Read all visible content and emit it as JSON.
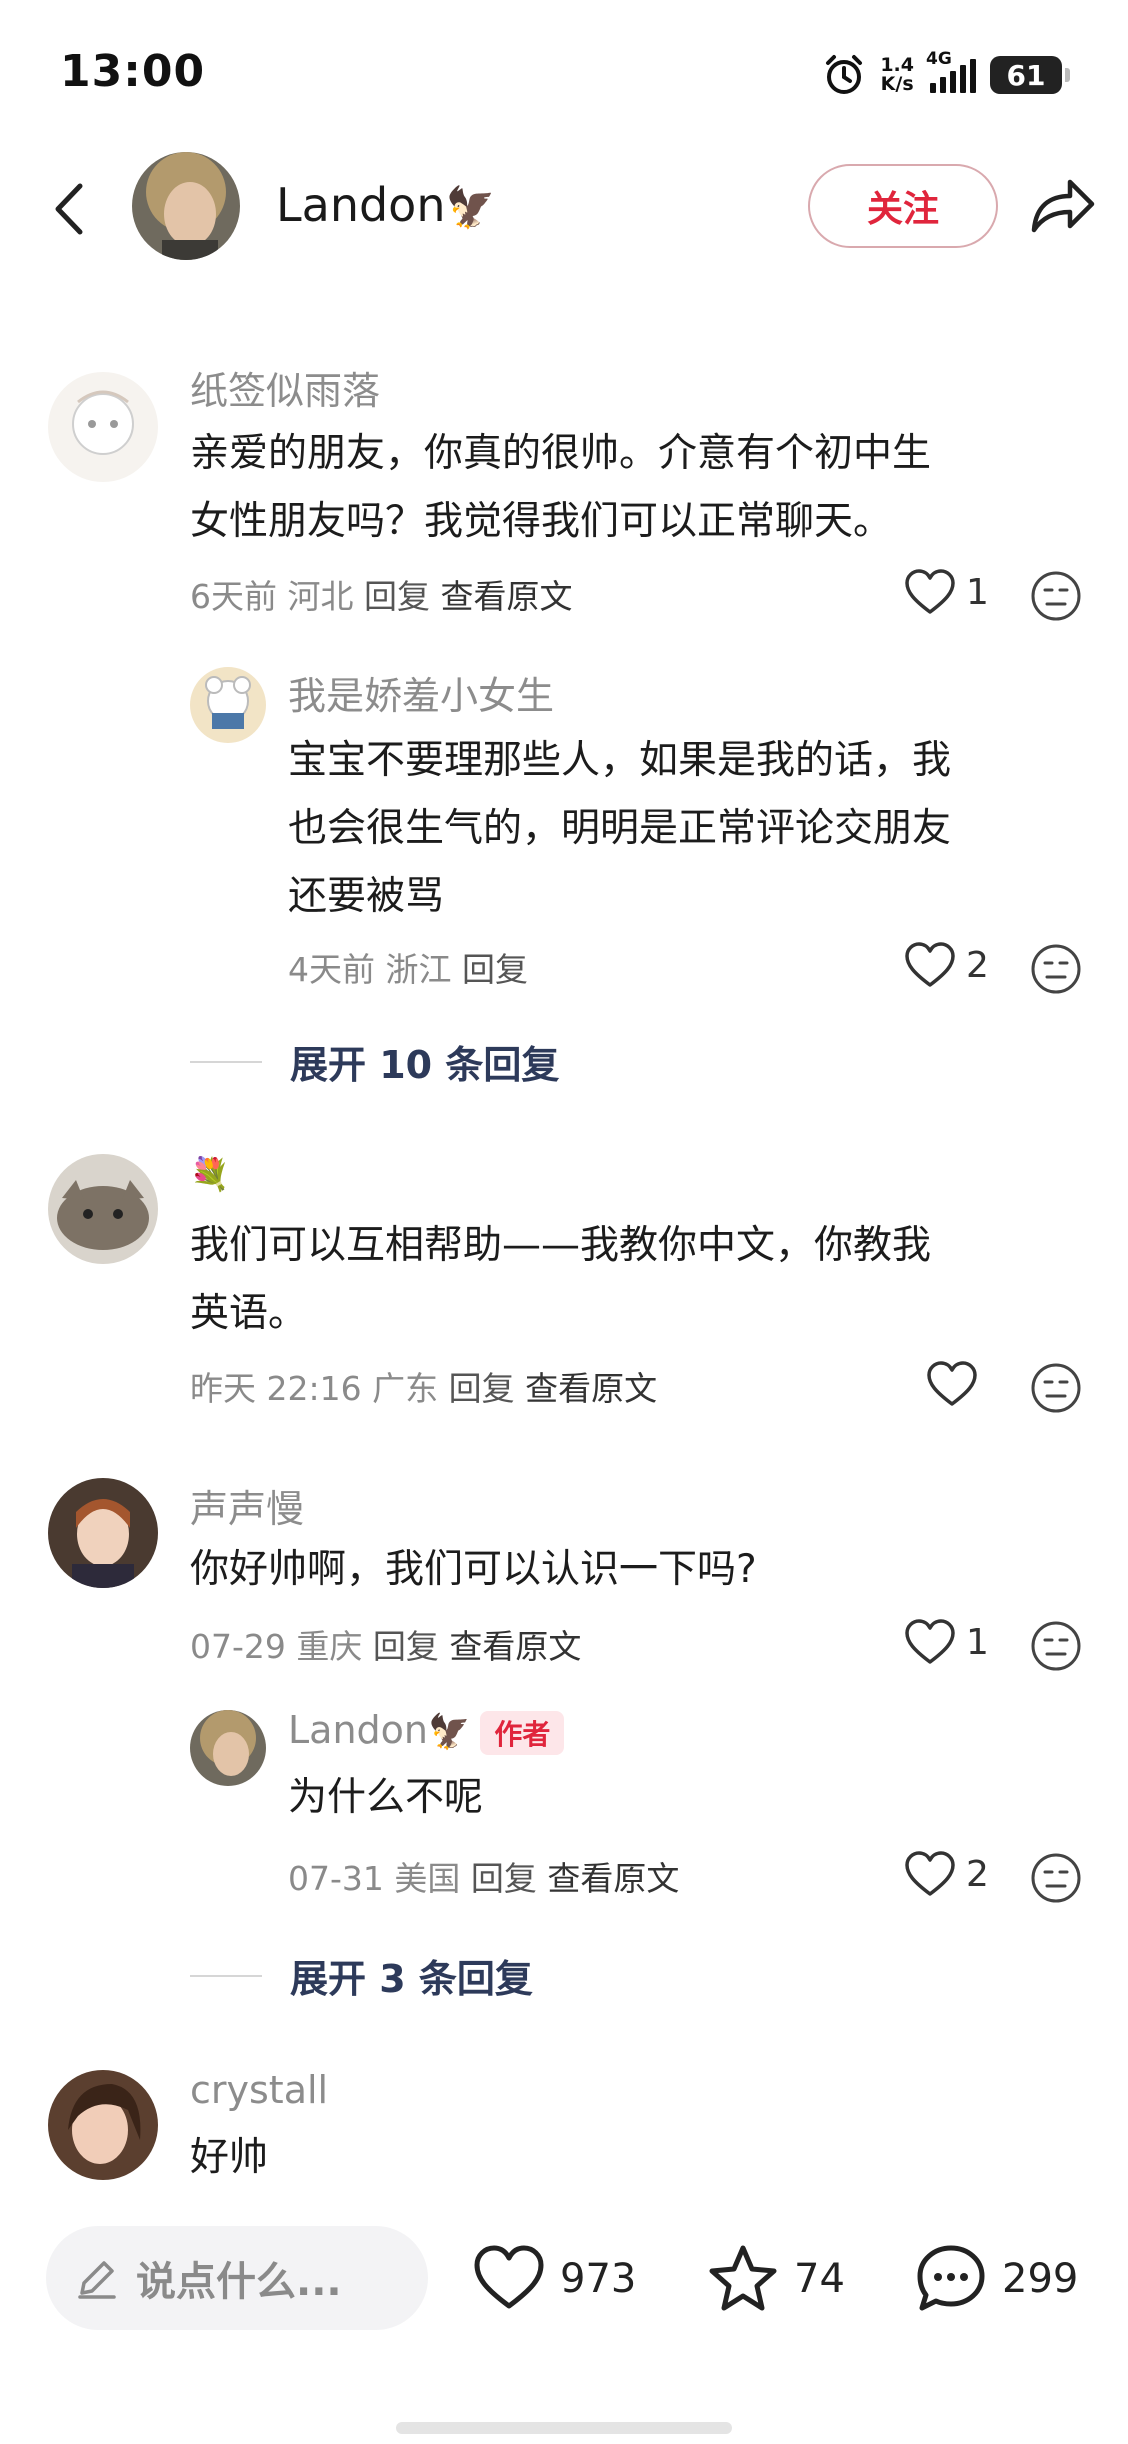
{
  "status": {
    "time": "13:00",
    "net_speed_top": "1.4",
    "net_speed_bottom": "K/s",
    "net_type": "4G",
    "battery": "61"
  },
  "header": {
    "username": "Landon",
    "follow_label": "关注"
  },
  "comments": [
    {
      "username": "纸签似雨落",
      "content_line1": "亲爱的朋友，你真的很帅。介意有个初中生",
      "content_line2": "女性朋友吗？我觉得我们可以正常聊天。",
      "time": "6天前",
      "location": "河北",
      "reply_label": "回复",
      "original_label": "查看原文",
      "likes": "1",
      "replies": [
        {
          "username": "我是娇羞小女生",
          "content_line1": "宝宝不要理那些人，如果是我的话，我",
          "content_line2": "也会很生气的，明明是正常评论交朋友",
          "content_line3": "还要被骂",
          "time": "4天前",
          "location": "浙江",
          "reply_label": "回复",
          "likes": "2"
        }
      ],
      "expand_label": "展开 10 条回复"
    },
    {
      "username": "",
      "content_line1": "我们可以互相帮助——我教你中文，你教我",
      "content_line2": "英语。",
      "time": "昨天 22:16",
      "location": "广东",
      "reply_label": "回复",
      "original_label": "查看原文",
      "likes": ""
    },
    {
      "username": "声声慢",
      "content_line1": "你好帅啊，我们可以认识一下吗?",
      "time": "07-29",
      "location": "重庆",
      "reply_label": "回复",
      "original_label": "查看原文",
      "likes": "1",
      "replies": [
        {
          "username": "Landon",
          "badge": "作者",
          "content_line1": "为什么不呢",
          "time": "07-31",
          "location": "美国",
          "reply_label": "回复",
          "original_label": "查看原文",
          "likes": "2"
        }
      ],
      "expand_label": "展开 3 条回复"
    },
    {
      "username": "crystall",
      "content_line1": "好帅"
    }
  ],
  "bottom_bar": {
    "input_placeholder": "说点什么...",
    "likes": "973",
    "favorites": "74",
    "comments": "299"
  },
  "icons": {
    "alarm": "alarm-clock-icon",
    "back": "back-arrow-icon",
    "share": "share-icon",
    "like": "heart-icon",
    "dislike": "dislike-face-icon",
    "edit": "pencil-icon",
    "favorite": "star-icon",
    "comment": "chat-bubble-icon"
  },
  "colors": {
    "accent": "#e0253c",
    "meta_text": "#8a8a8a",
    "expand_text": "#2d3a5a"
  }
}
